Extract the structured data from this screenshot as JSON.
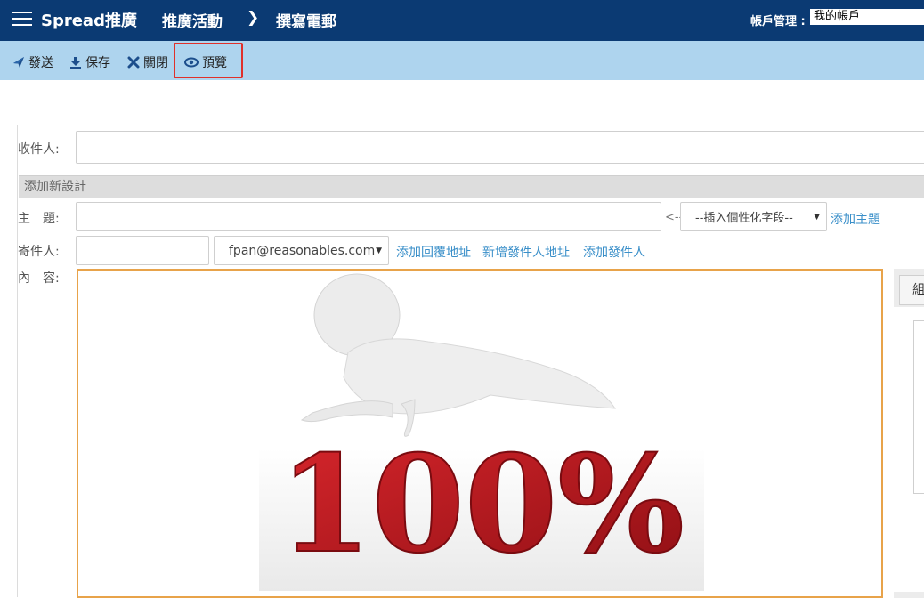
{
  "header": {
    "brand": "Spread推廣",
    "breadcrumb": [
      "推廣活動",
      "撰寫電郵"
    ],
    "account_label": "帳戶管理 :",
    "account_value": "我的帳戶"
  },
  "toolbar": {
    "send_label": "發送",
    "save_label": "保存",
    "close_label": "關閉",
    "preview_label": "預覽",
    "highlight_color": "#e0302a"
  },
  "form": {
    "recipient_label": "收件人:",
    "recipient_value": "",
    "add_design_label": "添加新設計",
    "subject_label": "主　題:",
    "subject_value": "",
    "insert_arrow": "<--",
    "insert_field_select": "--插入個性化字段--",
    "add_subject_link": "添加主題",
    "sender_label": "寄件人:",
    "sender_name_value": "",
    "sender_email_select": "fpan@reasonables.com",
    "add_reply_link": "添加回覆地址",
    "add_sender_address_link": "新增發件人地址",
    "add_sender_link": "添加發件人",
    "content_label": "內　容:",
    "right_tab_label": "組"
  },
  "image": {
    "percent_text": "100%"
  },
  "colors": {
    "header_bg": "#0b3a73",
    "toolbar_bg": "#aed4ee",
    "link": "#3a8fc9",
    "editor_border": "#e8a34a",
    "percent_red": "#c0171d"
  },
  "icons": [
    "menu-icon",
    "send-icon",
    "save-icon",
    "close-icon",
    "eye-icon",
    "chevron-right-icon",
    "dropdown-arrow-icon"
  ]
}
